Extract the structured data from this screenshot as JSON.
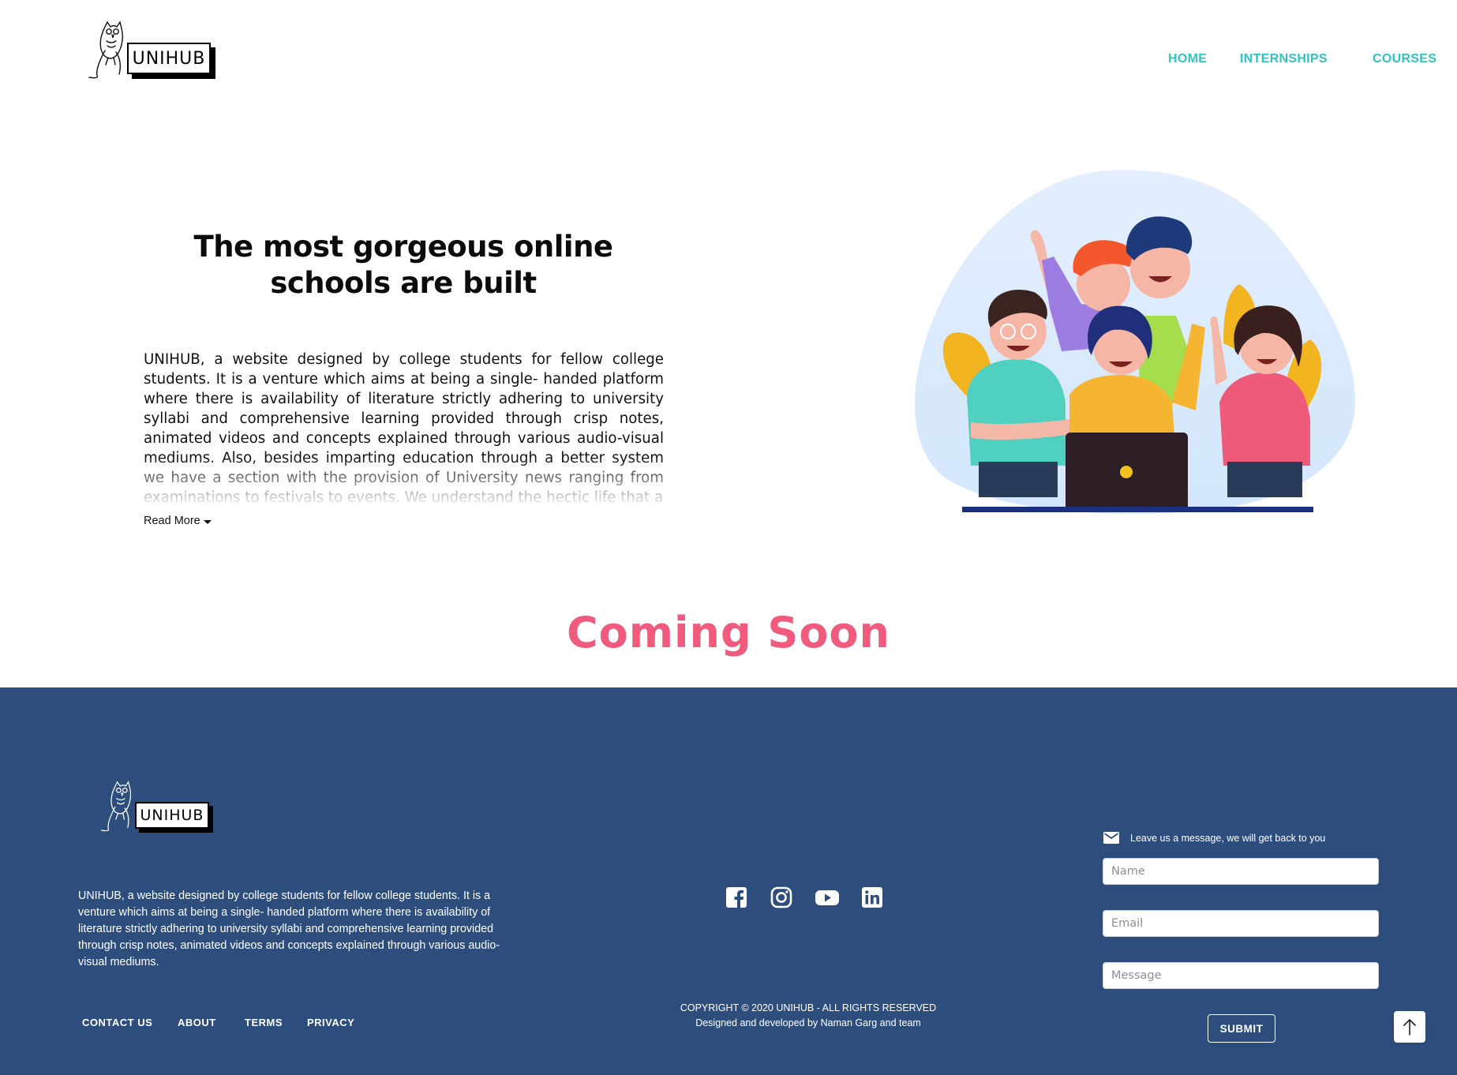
{
  "brand": {
    "name": "UNIHUB"
  },
  "nav": {
    "home": "HOME",
    "internships": "INTERNSHIPS",
    "courses": "COURSES"
  },
  "hero": {
    "title_line1": "The most gorgeous online",
    "title_line2": "schools are built",
    "description": "UNIHUB, a website designed by college students for fellow college students. It is a venture which aims at being a single- handed platform where there is availability of literature strictly adhering to university syllabi and comprehensive learning provided through crisp notes, animated videos and concepts explained through various audio-visual mediums. Also, besides imparting education through a better system we have a section with the provision of University news ranging from examinations to festivals to events. We understand the hectic life that a",
    "read_more": "Read More",
    "illustration": "group-of-students-with-laptop-illustration"
  },
  "coming_soon": "Coming Soon",
  "footer": {
    "about": "UNIHUB, a website designed by college students for fellow college students. It is a venture which aims at being a single- handed platform where there is availability of literature strictly adhering to university syllabi and comprehensive learning provided through crisp notes, animated videos and concepts explained through various audio-visual mediums.",
    "links": {
      "contact": "CONTACT US",
      "about": "ABOUT",
      "terms": "TERMS",
      "privacy": "PRIVACY"
    },
    "socials": [
      "facebook-icon",
      "instagram-icon",
      "youtube-icon",
      "linkedin-icon"
    ],
    "copyright": "COPYRIGHT © 2020 UNIHUB - ALL RIGHTS RESERVED",
    "credits": "Designed and developed by Naman Garg and team",
    "contact_form": {
      "heading": "Leave us a message, we will get back to you",
      "name_placeholder": "Name",
      "email_placeholder": "Email",
      "message_placeholder": "Message",
      "submit": "SUBMIT"
    }
  },
  "colors": {
    "nav_accent": "#2ec4c0",
    "coming_soon": "#ef5a7d",
    "footer_bg": "#2d4e7c"
  }
}
